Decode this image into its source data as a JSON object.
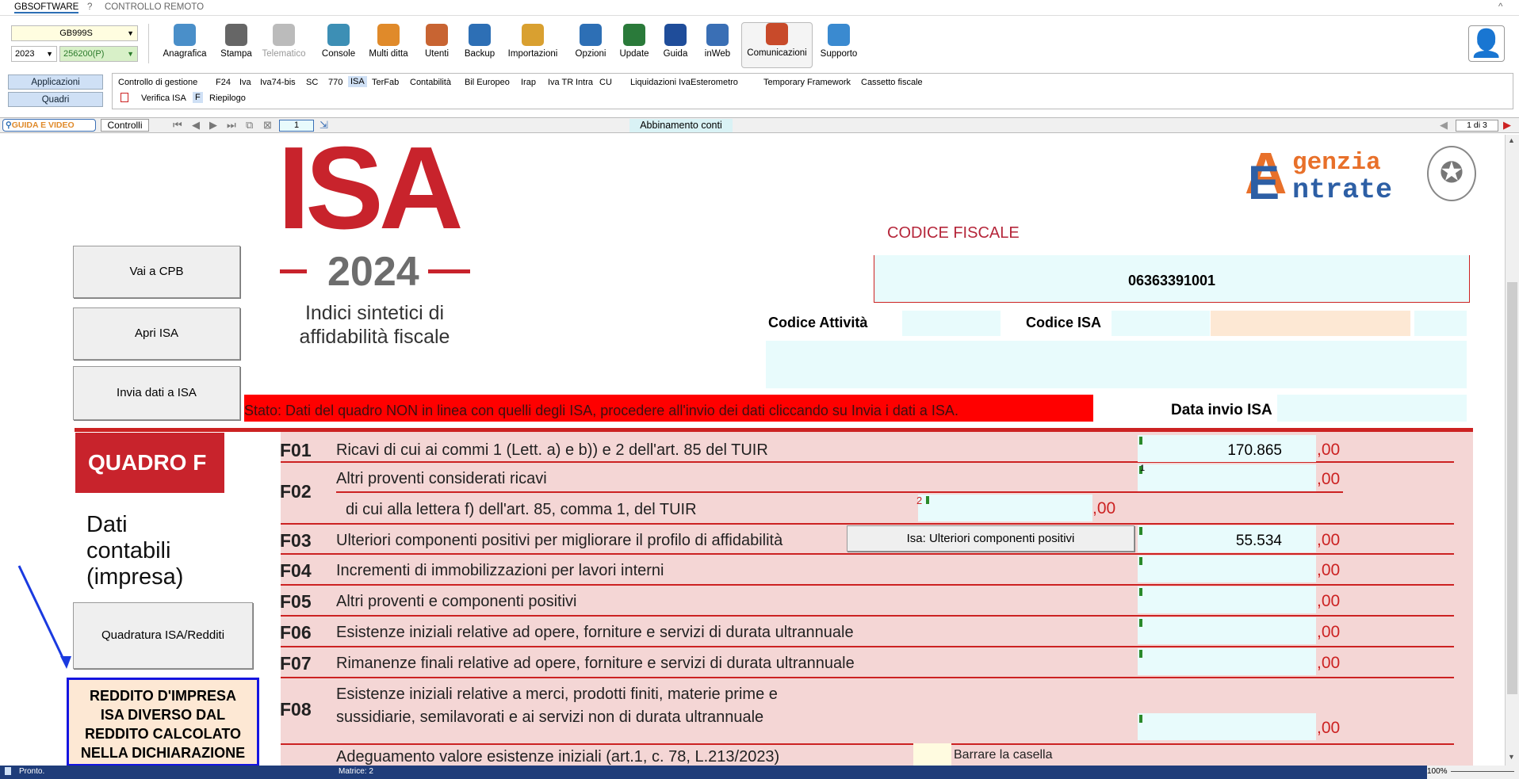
{
  "menubar": {
    "app": "GBSOFTWARE",
    "help": "?",
    "remote": "CONTROLLO REMOTO",
    "collapse": "^"
  },
  "toolbar": {
    "company_select": "GB999S",
    "year_select": "2023",
    "code_select": "256200(P)",
    "buttons": [
      {
        "label": "Anagrafica",
        "icon": "id-card-icon",
        "color": "#4a8fc9"
      },
      {
        "label": "Stampa",
        "icon": "printer-icon",
        "color": "#666"
      },
      {
        "label": "Telematico",
        "icon": "telematic-icon",
        "color": "#bbb"
      },
      {
        "label": "Console",
        "icon": "console-icon",
        "color": "#3d8fb5"
      },
      {
        "label": "Multi ditta",
        "icon": "multi-company-icon",
        "color": "#e08a2a"
      },
      {
        "label": "Utenti",
        "icon": "users-icon",
        "color": "#c86432"
      },
      {
        "label": "Backup",
        "icon": "backup-icon",
        "color": "#2d6fb5"
      },
      {
        "label": "Importazioni",
        "icon": "import-icon",
        "color": "#d9a030"
      },
      {
        "label": "Opzioni",
        "icon": "gear-icon",
        "color": "#2d6fb5"
      },
      {
        "label": "Update",
        "icon": "update-icon",
        "color": "#2a7a3a"
      },
      {
        "label": "Guida",
        "icon": "help-icon",
        "color": "#1f4d9a"
      },
      {
        "label": "inWeb",
        "icon": "cloud-icon",
        "color": "#3a6fb5"
      },
      {
        "label": "Comunicazioni",
        "icon": "megaphone-icon",
        "color": "#c84a2a"
      },
      {
        "label": "Supporto",
        "icon": "support-icon",
        "color": "#3a8ad0"
      }
    ]
  },
  "nav": {
    "applicazioni": "Applicazioni",
    "quadri": "Quadri",
    "tabs": [
      "Controllo di gestione",
      "F24",
      "Iva",
      "Iva74-bis",
      "SC",
      "770",
      "ISA",
      "TerFab",
      "Contabilità",
      "Bil Europeo",
      "Irap",
      "Iva TR",
      "Intra",
      "CU",
      "Liquidazioni Iva",
      "Esterometro",
      "Temporary Framework",
      "Cassetto fiscale"
    ],
    "subtabs": [
      "Verifica ISA",
      "F",
      "Riepilogo"
    ]
  },
  "subbar": {
    "guide": "GUIDA E VIDEO",
    "controlli": "Controlli",
    "page": "1",
    "abbinamento": "Abbinamento conti",
    "page_of": "1 di 3"
  },
  "header": {
    "isa": "ISA",
    "year": "2024",
    "subtitle1": "Indici sintetici di",
    "subtitle2": "affidabilità fiscale",
    "agenzia1": "genzia",
    "agenzia2": "ntrate",
    "codice_fiscale_label": "CODICE FISCALE",
    "codice_fiscale": "06363391001",
    "codice_attivita_label": "Codice Attività",
    "codice_isa_label": "Codice ISA",
    "data_invio_label": "Data invio ISA"
  },
  "side": {
    "vai_cpb": "Vai a CPB",
    "apri_isa": "Apri ISA",
    "invia_isa": "Invia dati a ISA",
    "quadratura": "Quadratura ISA/Redditi",
    "quadro": "QUADRO F",
    "dati1": "Dati",
    "dati2": "contabili",
    "dati3": "(impresa)",
    "warning": "REDDITO D'IMPRESA ISA DIVERSO DAL REDDITO CALCOLATO NELLA DICHIARAZIONE"
  },
  "stato": "Stato: Dati del quadro NON in linea con quelli degli ISA, procedere all'invio dei dati cliccando su Invia i dati a ISA.",
  "rows": [
    {
      "code": "F01",
      "desc": "Ricavi di cui ai commi 1 (Lett. a) e b)) e 2 dell'art. 85 del TUIR",
      "value": "170.865",
      "dec": ",00"
    },
    {
      "code": "F02",
      "desc": "Altri proventi considerati ricavi",
      "desc2": "di cui alla lettera f) dell'art. 85, comma 1, del TUIR",
      "value": "",
      "dec": ",00",
      "sub_index": "2",
      "idx": "1"
    },
    {
      "code": "F03",
      "desc": "Ulteriori componenti positivi per migliorare il profilo di affidabilità",
      "button": "Isa: Ulteriori componenti positivi",
      "value": "55.534",
      "dec": ",00"
    },
    {
      "code": "F04",
      "desc": "Incrementi di immobilizzazioni per lavori interni",
      "value": "",
      "dec": ",00"
    },
    {
      "code": "F05",
      "desc": "Altri proventi e componenti positivi",
      "value": "",
      "dec": ",00"
    },
    {
      "code": "F06",
      "desc": "Esistenze iniziali relative ad opere, forniture e servizi di durata ultrannuale",
      "value": "",
      "dec": ",00"
    },
    {
      "code": "F07",
      "desc": "Rimanenze finali relative ad opere, forniture e servizi di durata ultrannuale",
      "value": "",
      "dec": ",00"
    },
    {
      "code": "F08",
      "desc": "Esistenze iniziali relative a merci, prodotti finiti, materie prime e",
      "desc2": "sussidiarie, semilavorati e ai servizi non di durata ultrannuale",
      "value": "",
      "dec": ",00"
    }
  ],
  "adeguamento": "Adeguamento valore esistenze iniziali (art.1, c. 78, L.213/2023)",
  "barrare": "Barrare la casella",
  "status": {
    "ready": "Pronto.",
    "matrice": "Matrice: 2",
    "zoom": "100%"
  }
}
